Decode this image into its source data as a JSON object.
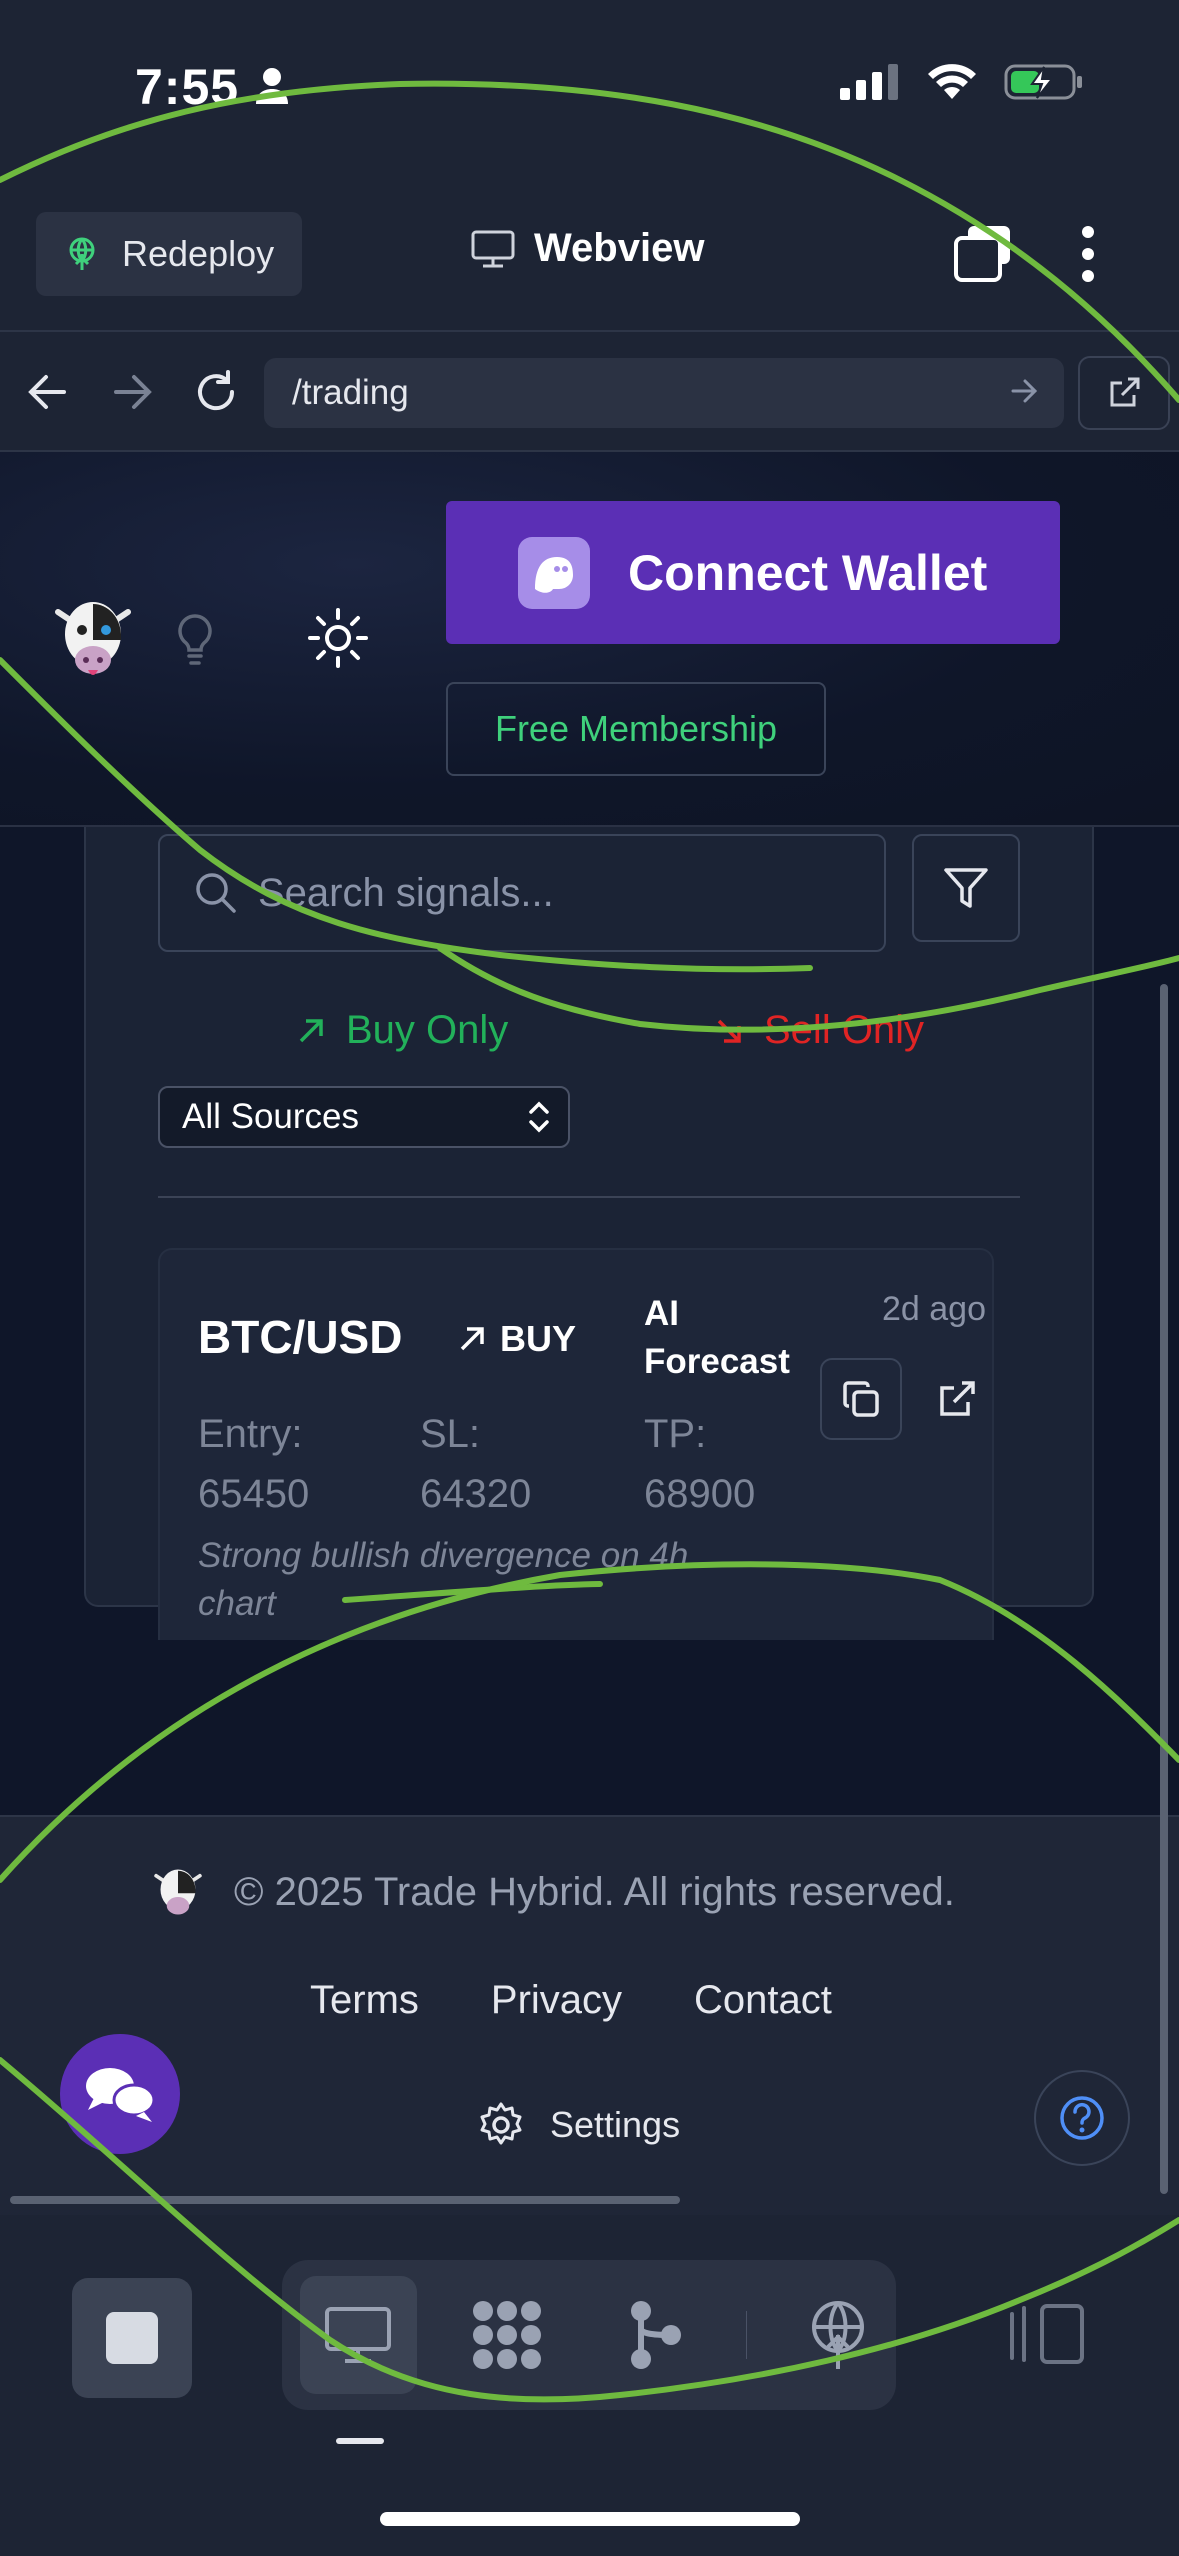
{
  "status_bar": {
    "time": "7:55"
  },
  "replit_header": {
    "redeploy_label": "Redeploy",
    "webview_title": "Webview"
  },
  "url_bar": {
    "path": "/trading"
  },
  "app_header": {
    "connect_wallet_label": "Connect Wallet",
    "free_membership_label": "Free Membership"
  },
  "signals": {
    "search_placeholder": "Search signals...",
    "buy_only_label": "Buy Only",
    "sell_only_label": "Sell Only",
    "source_filter_value": "All Sources",
    "items": [
      {
        "pair": "BTC/USD",
        "direction": "BUY",
        "source": "AI Forecast",
        "age": "2d ago",
        "entry_label": "Entry:",
        "entry_value": "65450",
        "sl_label": "SL:",
        "sl_value": "64320",
        "tp_label": "TP:",
        "tp_value": "68900",
        "note": "Strong bullish divergence on 4h chart"
      }
    ]
  },
  "footer": {
    "copyright": "© 2025 Trade Hybrid. All rights reserved.",
    "links": [
      "Terms",
      "Privacy",
      "Contact"
    ],
    "settings_label": "Settings"
  },
  "colors": {
    "accent_purple": "#5b2fb5",
    "buy_green": "#22b15a",
    "sell_red": "#e02424",
    "membership_green": "#3fd17c",
    "annotation_green": "#6fba3f"
  },
  "icons": [
    "person-icon",
    "signal-bars-icon",
    "wifi-icon",
    "battery-charging-icon",
    "deploy-icon",
    "monitor-icon",
    "tabs-icon",
    "more-vertical-icon",
    "back-icon",
    "forward-icon",
    "reload-icon",
    "external-link-icon",
    "cow-logo-icon",
    "lightbulb-icon",
    "sun-icon",
    "ghost-icon",
    "search-icon",
    "filter-icon",
    "arrow-up-right-icon",
    "arrow-down-right-icon",
    "chevron-updown-icon",
    "copy-icon",
    "chat-icon",
    "help-icon",
    "gear-icon",
    "stop-icon",
    "workflow-icon",
    "git-icon",
    "deploy-globe-icon",
    "panels-icon"
  ]
}
